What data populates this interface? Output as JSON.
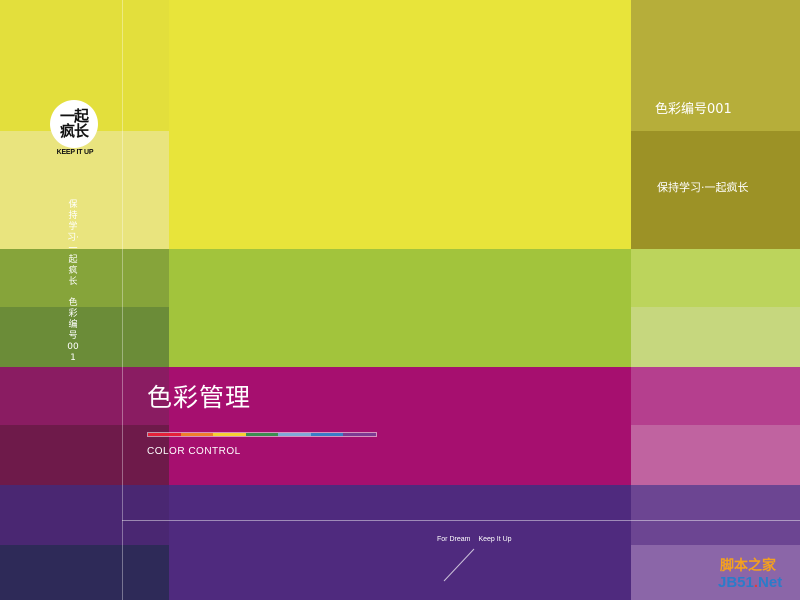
{
  "logo": {
    "line1": "一起",
    "line2": "疯长",
    "tagline": "KEEP IT UP"
  },
  "slogan_vertical": {
    "part1": "保持学习·一起疯长",
    "part2": "色彩 编号001"
  },
  "main": {
    "title": "色彩管理",
    "subtitle": "COLOR CONTROL"
  },
  "right": {
    "code": "色彩编号001",
    "motto": "保持学习·一起疯长"
  },
  "footer": {
    "for_dream": "For Dream",
    "keep_it_up": "Keep It Up"
  },
  "watermark": {
    "top": "脚本之家",
    "jb": "JB51",
    "dot": ".",
    "net": "Net"
  },
  "colors": {
    "main_yellow": "#E8E43A",
    "main_green": "#A2C43C",
    "main_magenta": "#A60F6F",
    "main_purple": "#4F2A7E",
    "stripe": [
      "#E5213A",
      "#F07F2C",
      "#F6D033",
      "#3C8E52",
      "#7FA9D8",
      "#3B7CC8",
      "#7D3B93"
    ]
  }
}
